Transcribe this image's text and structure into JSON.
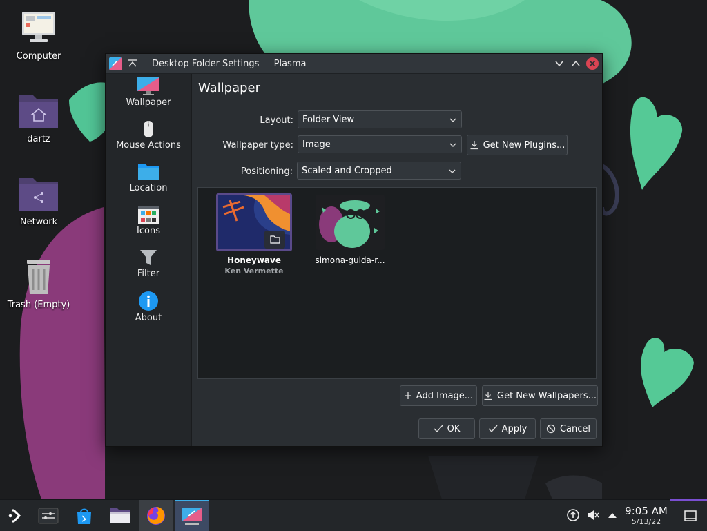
{
  "desktop": {
    "icons": [
      {
        "label": "Computer"
      },
      {
        "label": "dartz"
      },
      {
        "label": "Network"
      },
      {
        "label": "Trash (Empty)"
      }
    ]
  },
  "window": {
    "title": "Desktop Folder Settings — Plasma",
    "sidebar": [
      {
        "label": "Wallpaper",
        "icon": "wallpaper-icon"
      },
      {
        "label": "Mouse Actions",
        "icon": "mouse-icon"
      },
      {
        "label": "Location",
        "icon": "folder-icon"
      },
      {
        "label": "Icons",
        "icon": "icons-icon"
      },
      {
        "label": "Filter",
        "icon": "filter-icon"
      },
      {
        "label": "About",
        "icon": "info-icon"
      }
    ],
    "heading": "Wallpaper",
    "form": {
      "layout_label": "Layout:",
      "layout_value": "Folder View",
      "type_label": "Wallpaper type:",
      "type_value": "Image",
      "get_plugins": "Get New Plugins...",
      "positioning_label": "Positioning:",
      "positioning_value": "Scaled and Cropped"
    },
    "wallpapers": [
      {
        "title": "Honeywave",
        "author": "Ken Vermette",
        "selected": true
      },
      {
        "title": "simona-guida-r...",
        "author": "",
        "selected": false
      }
    ],
    "buttons": {
      "add_image": "Add Image...",
      "get_wallpapers": "Get New Wallpapers...",
      "ok": "OK",
      "apply": "Apply",
      "cancel": "Cancel"
    }
  },
  "taskbar": {
    "time": "9:05 AM",
    "date": "5/13/22"
  },
  "colors": {
    "accent": "#3daee9",
    "wallpaper_green": "#5fcf9f",
    "wallpaper_purple": "#8a3a7a",
    "close_red": "#da4453"
  }
}
